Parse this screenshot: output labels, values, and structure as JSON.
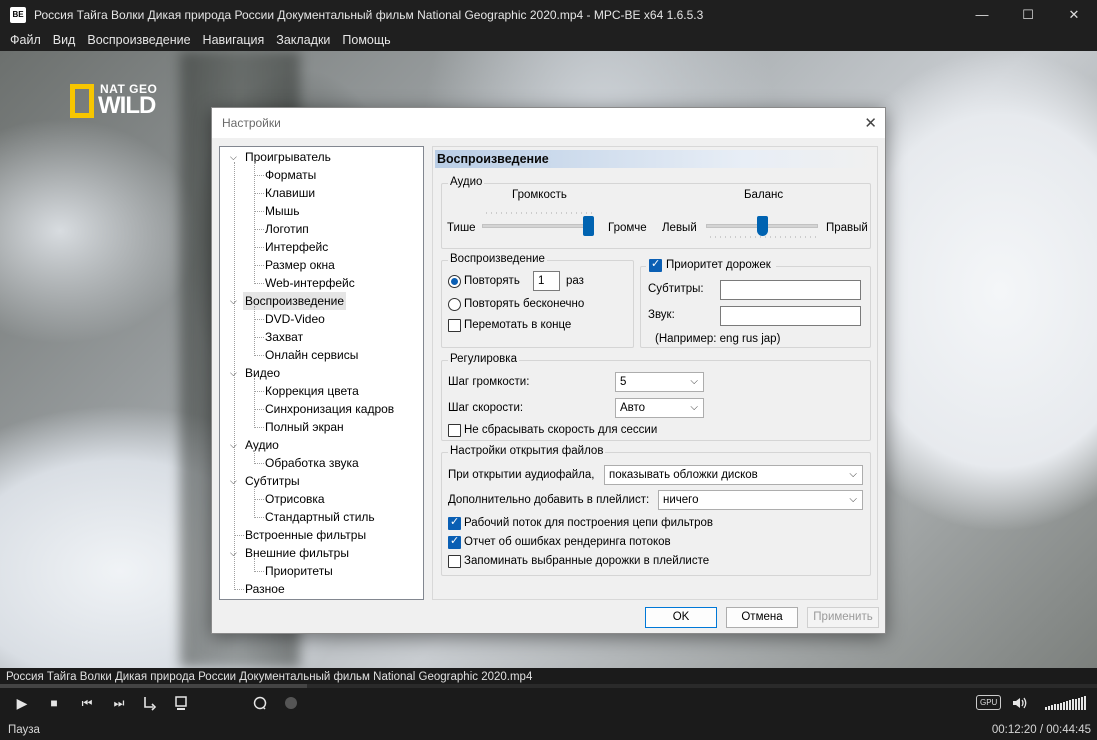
{
  "window": {
    "title": "Россия Тайга Волки Дикая природа России Документальный фильм National Geographic 2020.mp4 - MPC-BE x64 1.6.5.3",
    "app_icon_text": "BE",
    "minimize": "—",
    "maximize": "☐",
    "close": "✕"
  },
  "menu": [
    "Файл",
    "Вид",
    "Воспроизведение",
    "Навигация",
    "Закладки",
    "Помощь"
  ],
  "video": {
    "logo_top": "NAT GEO",
    "logo_main": "WILD",
    "now_playing": "Россия Тайга Волки Дикая природа России Документальный фильм National Geographic 2020.mp4",
    "seek_fraction": 0.28
  },
  "controls": {
    "play": "▶",
    "stop": "■",
    "prev": "⏮",
    "next": "⏭",
    "gpu_label": "GPU",
    "volume_icon": "🔊",
    "volume_level": 1.0
  },
  "status": {
    "state": "Пауза",
    "time": "00:12:20 / 00:44:45"
  },
  "dialog": {
    "title": "Настройки",
    "close": "✕",
    "tree": [
      {
        "label": "Проигрыватель",
        "level": 0,
        "expanded": true
      },
      {
        "label": "Форматы",
        "level": 1
      },
      {
        "label": "Клавиши",
        "level": 1
      },
      {
        "label": "Мышь",
        "level": 1
      },
      {
        "label": "Логотип",
        "level": 1
      },
      {
        "label": "Интерфейс",
        "level": 1
      },
      {
        "label": "Размер окна",
        "level": 1
      },
      {
        "label": "Web-интерфейс",
        "level": 1
      },
      {
        "label": "Воспроизведение",
        "level": 0,
        "expanded": true,
        "selected": true
      },
      {
        "label": "DVD-Video",
        "level": 1
      },
      {
        "label": "Захват",
        "level": 1
      },
      {
        "label": "Онлайн сервисы",
        "level": 1
      },
      {
        "label": "Видео",
        "level": 0,
        "expanded": true
      },
      {
        "label": "Коррекция цвета",
        "level": 1
      },
      {
        "label": "Синхронизация кадров",
        "level": 1
      },
      {
        "label": "Полный экран",
        "level": 1
      },
      {
        "label": "Аудио",
        "level": 0,
        "expanded": true
      },
      {
        "label": "Обработка звука",
        "level": 1
      },
      {
        "label": "Субтитры",
        "level": 0,
        "expanded": true
      },
      {
        "label": "Отрисовка",
        "level": 1
      },
      {
        "label": "Стандартный стиль",
        "level": 1
      },
      {
        "label": "Встроенные фильтры",
        "level": 0
      },
      {
        "label": "Внешние фильтры",
        "level": 0,
        "expanded": true
      },
      {
        "label": "Приоритеты",
        "level": 1
      },
      {
        "label": "Разное",
        "level": 0
      }
    ],
    "panel": {
      "header": "Воспроизведение",
      "audio": {
        "title": "Аудио",
        "volume_label": "Громкость",
        "volume_min": "Тише",
        "volume_max": "Громче",
        "volume_value": 1.0,
        "balance_label": "Баланс",
        "balance_min": "Левый",
        "balance_max": "Правый",
        "balance_value": 0.5
      },
      "playback": {
        "title": "Воспроизведение",
        "repeat_label": "Повторять",
        "repeat_count": "1",
        "repeat_unit": "раз",
        "repeat_forever": "Повторять бесконечно",
        "rewind_at_end": "Перемотать в конце"
      },
      "track_priority": {
        "title": "Приоритет дорожек",
        "subtitles_label": "Субтитры:",
        "subtitles_value": "",
        "audio_label": "Звук:",
        "audio_value": "",
        "example": "(Например: eng rus jap)"
      },
      "adjust": {
        "title": "Регулировка",
        "volume_step_label": "Шаг громкости:",
        "volume_step_value": "5",
        "speed_step_label": "Шаг скорости:",
        "speed_step_value": "Авто",
        "no_reset_speed": "Не сбрасывать скорость для сессии"
      },
      "file_open": {
        "title": "Настройки открытия файлов",
        "audio_file_label": "При открытии аудиофайла,",
        "audio_file_value": "показывать обложки дисков",
        "add_playlist_label": "Дополнительно добавить в плейлист:",
        "add_playlist_value": "ничего",
        "worker_thread": "Рабочий поток для построения цепи фильтров",
        "render_errors": "Отчет об ошибках рендеринга потоков",
        "remember_tracks": "Запоминать выбранные дорожки в плейлисте"
      }
    },
    "buttons": {
      "ok": "OK",
      "cancel": "Отмена",
      "apply": "Применить"
    }
  }
}
